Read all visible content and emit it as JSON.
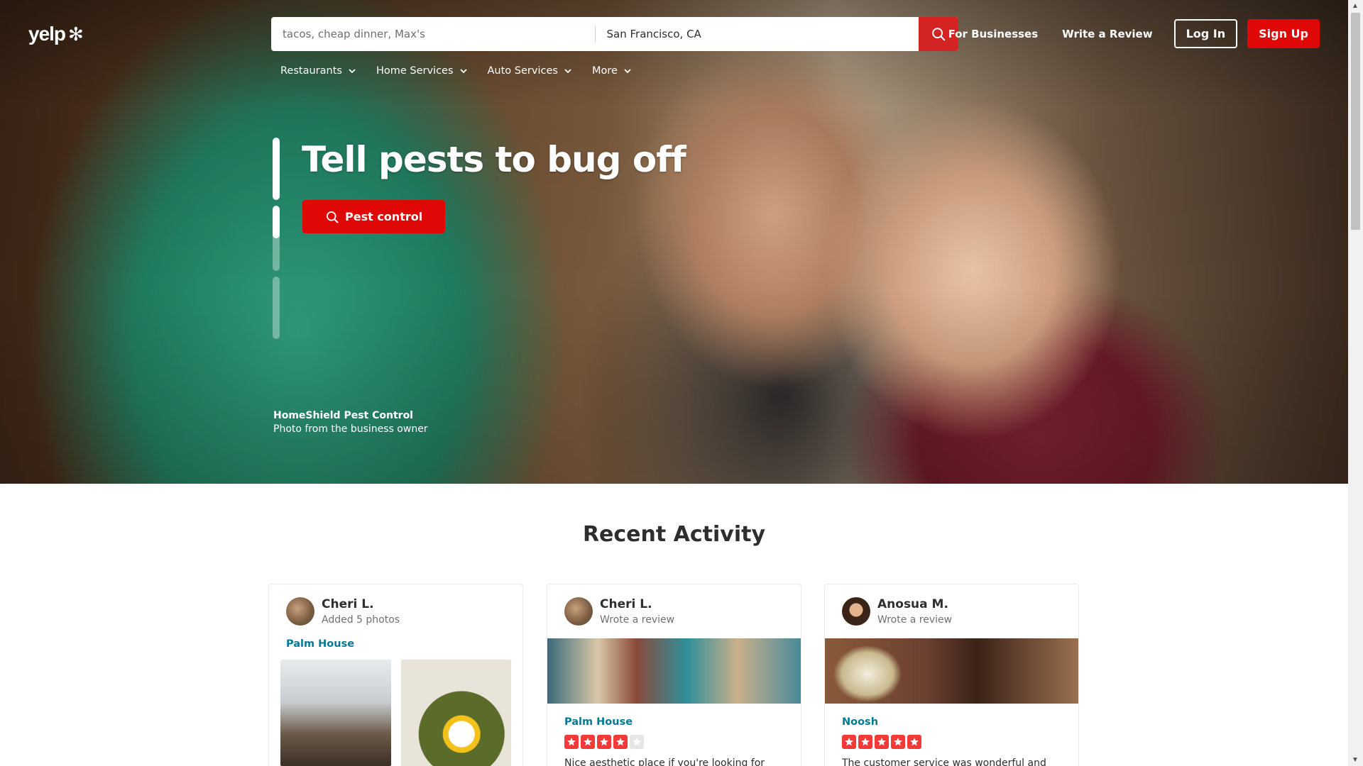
{
  "brand": {
    "logo_text": "yelp",
    "logo_icon": "yelp-burst-icon",
    "accent": "#d32323"
  },
  "search": {
    "find_placeholder": "tacos, cheap dinner, Max's",
    "near_value": "San Francisco, CA",
    "button_icon": "search-icon"
  },
  "header_links": {
    "for_businesses": "For Businesses",
    "write_review": "Write a Review",
    "log_in": "Log In",
    "sign_up": "Sign Up"
  },
  "categories": [
    {
      "label": "Restaurants",
      "icon": "chevron-down-icon"
    },
    {
      "label": "Home Services",
      "icon": "chevron-down-icon"
    },
    {
      "label": "Auto Services",
      "icon": "chevron-down-icon"
    },
    {
      "label": "More",
      "icon": "chevron-down-icon"
    }
  ],
  "hero": {
    "headline": "Tell pests to bug off",
    "cta_label": "Pest control",
    "cta_icon": "search-icon",
    "slides_progress": [
      1.0,
      0.5,
      0.0
    ],
    "credit_business": "HomeShield Pest Control",
    "credit_text": "Photo from the business owner"
  },
  "recent_activity": {
    "title": "Recent Activity",
    "cards": [
      {
        "user": "Cheri L.",
        "action": "Added 5 photos",
        "business": "Palm House"
      },
      {
        "user": "Cheri L.",
        "action": "Wrote a review",
        "business": "Palm House",
        "rating": 4,
        "snippet": "Nice aesthetic place if you're looking for"
      },
      {
        "user": "Anosua M.",
        "action": "Wrote a review",
        "business": "Noosh",
        "rating": 5,
        "snippet": "The customer service was wonderful and the"
      }
    ]
  },
  "colors": {
    "star_filled": "#f43939",
    "star_empty": "#e6e6e6",
    "link": "#027a97"
  }
}
